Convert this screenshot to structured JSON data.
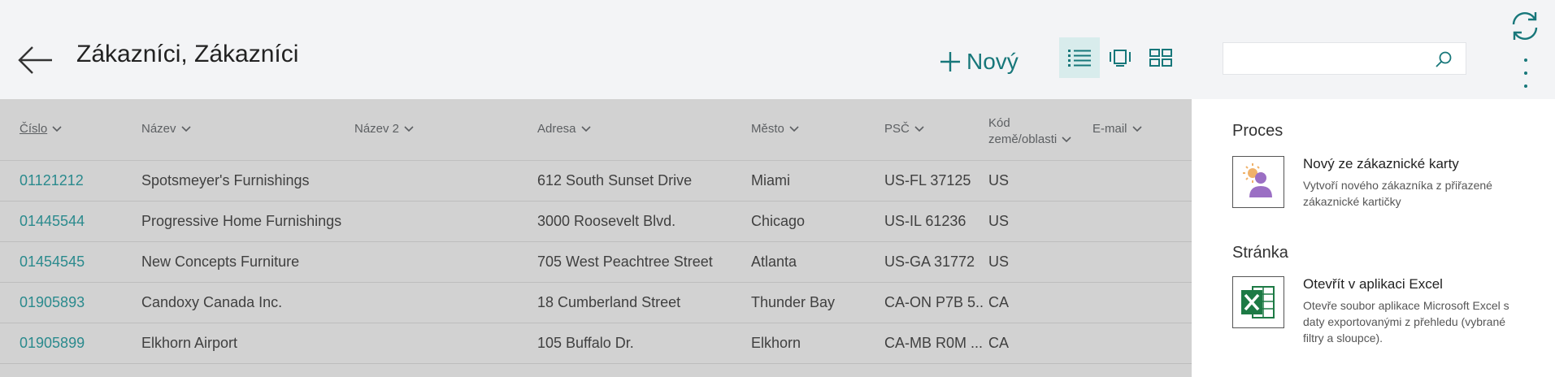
{
  "header": {
    "title": "Zákazníci, Zákazníci",
    "new_label": "Nový",
    "search_placeholder": ""
  },
  "columns": [
    "Číslo",
    "Název",
    "Název 2",
    "Adresa",
    "Město",
    "PSČ",
    "Kód země/oblasti",
    "E-mail"
  ],
  "column_lines": {
    "kod_line1": "Kód",
    "kod_line2": "země/oblasti"
  },
  "rows": [
    {
      "cislo": "01121212",
      "nazev": "Spotsmeyer's Furnishings",
      "nazev2": "",
      "adresa": "612 South Sunset Drive",
      "mesto": "Miami",
      "psc": "US-FL 37125",
      "kod": "US",
      "email": ""
    },
    {
      "cislo": "01445544",
      "nazev": "Progressive Home Furnishings",
      "nazev2": "",
      "adresa": "3000 Roosevelt Blvd.",
      "mesto": "Chicago",
      "psc": "US-IL 61236",
      "kod": "US",
      "email": ""
    },
    {
      "cislo": "01454545",
      "nazev": "New Concepts Furniture",
      "nazev2": "",
      "adresa": "705 West Peachtree Street",
      "mesto": "Atlanta",
      "psc": "US-GA 31772",
      "kod": "US",
      "email": ""
    },
    {
      "cislo": "01905893",
      "nazev": "Candoxy Canada Inc.",
      "nazev2": "",
      "adresa": "18 Cumberland Street",
      "mesto": "Thunder Bay",
      "psc": "CA-ON P7B 5...",
      "kod": "CA",
      "email": ""
    },
    {
      "cislo": "01905899",
      "nazev": "Elkhorn Airport",
      "nazev2": "",
      "adresa": "105 Buffalo Dr.",
      "mesto": "Elkhorn",
      "psc": "CA-MB R0M ...",
      "kod": "CA",
      "email": ""
    }
  ],
  "panel": {
    "section_process": "Proces",
    "action_new_title": "Nový ze zákaznické karty",
    "action_new_desc": "Vytvoří nového zákazníka z přiřazené zákaznické kartičky",
    "section_page": "Stránka",
    "action_excel_title": "Otevřít v aplikaci Excel",
    "action_excel_desc": "Otevře soubor aplikace Microsoft Excel s daty exportovanými z přehledu (vybrané filtry a sloupce)."
  },
  "colors": {
    "accent": "#17777a",
    "link": "#2a8a8d",
    "overlay": "#d2d2d2"
  },
  "icons": [
    "back-arrow-icon",
    "plus-icon",
    "list-view-icon",
    "card-view-icon",
    "tile-view-icon",
    "search-icon",
    "refresh-icon",
    "more-icon",
    "new-customer-icon",
    "excel-icon",
    "chevron-down-icon"
  ]
}
